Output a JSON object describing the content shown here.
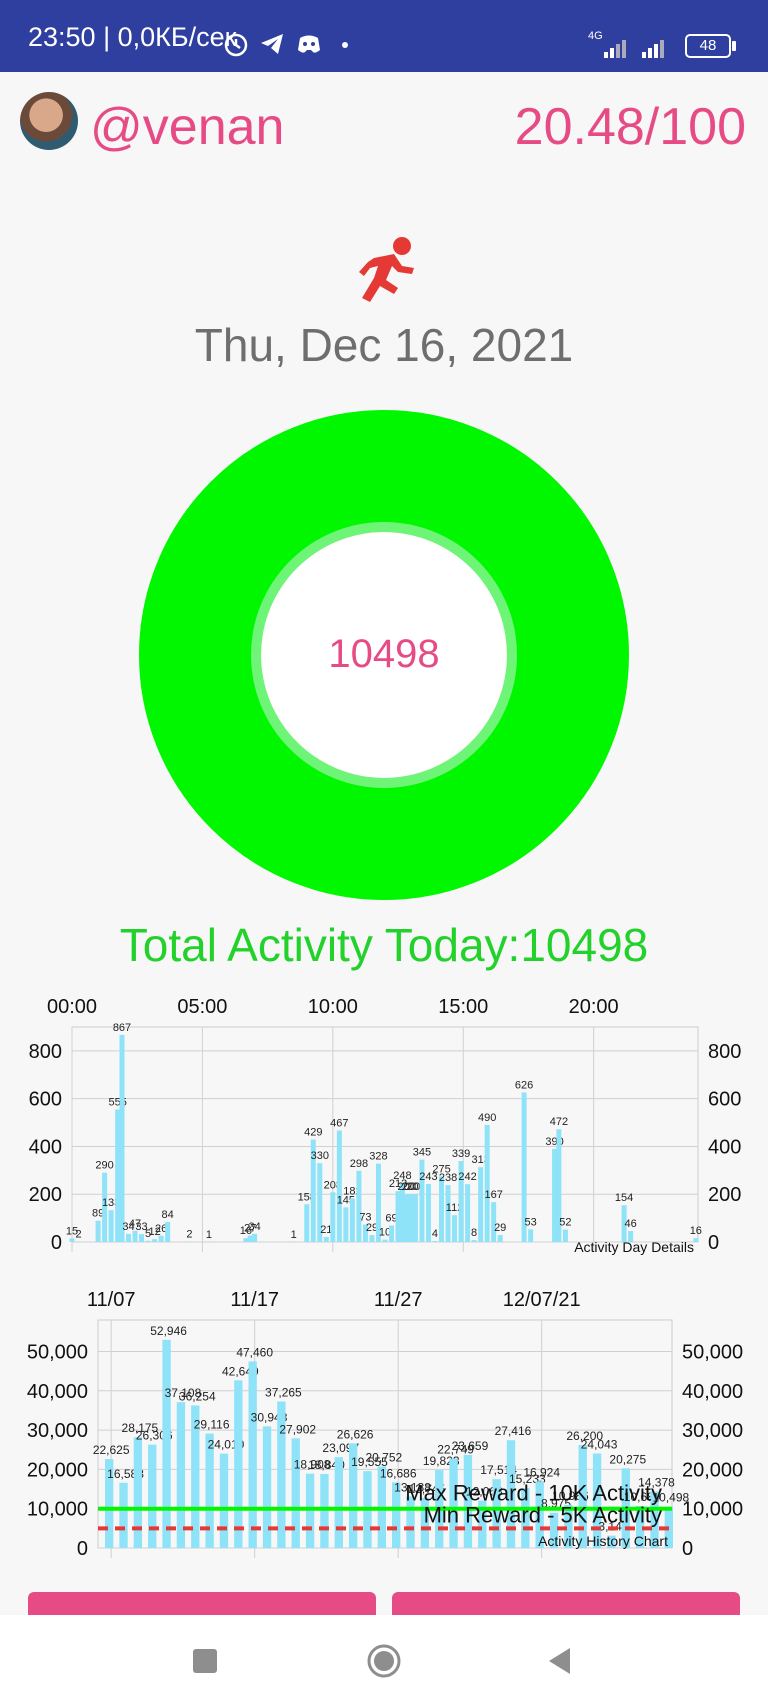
{
  "status": {
    "time": "23:50 | 0,0КБ/сек",
    "network": "4G",
    "battery": "48"
  },
  "header": {
    "username": "@venan",
    "score": "20.48/100"
  },
  "date": "Thu, Dec 16, 2021",
  "donut": {
    "value": "10498",
    "progress": 1.0
  },
  "total_activity": "Total Activity Today:10498",
  "colors": {
    "accent_pink": "#e64b86",
    "green": "#22d12a",
    "ring_green": "#00f700",
    "bar_blue": "#8fe3f9",
    "status_bar": "#2f3f9f",
    "min_line": "#e53935"
  },
  "chart_data": [
    {
      "type": "bar",
      "title": "",
      "label": "Activity Day Details",
      "x_ticks": [
        "00:00",
        "05:00",
        "10:00",
        "15:00",
        "20:00"
      ],
      "y_ticks": [
        "0",
        "200",
        "400",
        "600",
        "800"
      ],
      "ylim": [
        0,
        900
      ],
      "x_range_minutes": [
        0,
        1440
      ],
      "grid": true,
      "points": [
        {
          "t": 0,
          "v": 15
        },
        {
          "t": 15,
          "v": 2
        },
        {
          "t": 60,
          "v": 89
        },
        {
          "t": 75,
          "v": 290
        },
        {
          "t": 90,
          "v": 133
        },
        {
          "t": 105,
          "v": 555
        },
        {
          "t": 115,
          "v": 867
        },
        {
          "t": 130,
          "v": 34
        },
        {
          "t": 145,
          "v": 47
        },
        {
          "t": 160,
          "v": 33
        },
        {
          "t": 175,
          "v": 5
        },
        {
          "t": 190,
          "v": 12
        },
        {
          "t": 205,
          "v": 26
        },
        {
          "t": 220,
          "v": 84
        },
        {
          "t": 270,
          "v": 2
        },
        {
          "t": 315,
          "v": 1
        },
        {
          "t": 400,
          "v": 16
        },
        {
          "t": 410,
          "v": 27
        },
        {
          "t": 420,
          "v": 34
        },
        {
          "t": 510,
          "v": 1
        },
        {
          "t": 540,
          "v": 158
        },
        {
          "t": 555,
          "v": 429
        },
        {
          "t": 570,
          "v": 330
        },
        {
          "t": 585,
          "v": 21
        },
        {
          "t": 600,
          "v": 208
        },
        {
          "t": 615,
          "v": 467
        },
        {
          "t": 630,
          "v": 145
        },
        {
          "t": 645,
          "v": 182
        },
        {
          "t": 660,
          "v": 298
        },
        {
          "t": 675,
          "v": 73
        },
        {
          "t": 690,
          "v": 29
        },
        {
          "t": 705,
          "v": 328
        },
        {
          "t": 720,
          "v": 10
        },
        {
          "t": 735,
          "v": 69
        },
        {
          "t": 750,
          "v": 213
        },
        {
          "t": 760,
          "v": 248
        },
        {
          "t": 770,
          "v": 200
        },
        {
          "t": 780,
          "v": 200
        },
        {
          "t": 790,
          "v": 200
        },
        {
          "t": 805,
          "v": 345
        },
        {
          "t": 820,
          "v": 243
        },
        {
          "t": 835,
          "v": 4
        },
        {
          "t": 850,
          "v": 275
        },
        {
          "t": 865,
          "v": 238
        },
        {
          "t": 880,
          "v": 112
        },
        {
          "t": 895,
          "v": 339
        },
        {
          "t": 910,
          "v": 242
        },
        {
          "t": 925,
          "v": 8
        },
        {
          "t": 940,
          "v": 313
        },
        {
          "t": 955,
          "v": 490
        },
        {
          "t": 970,
          "v": 167
        },
        {
          "t": 985,
          "v": 29
        },
        {
          "t": 1040,
          "v": 626
        },
        {
          "t": 1055,
          "v": 53
        },
        {
          "t": 1110,
          "v": 390
        },
        {
          "t": 1120,
          "v": 472
        },
        {
          "t": 1135,
          "v": 52
        },
        {
          "t": 1270,
          "v": 154
        },
        {
          "t": 1285,
          "v": 46
        },
        {
          "t": 1435,
          "v": 16
        }
      ]
    },
    {
      "type": "bar",
      "title": "",
      "label": "Activity History Chart",
      "x_ticks": [
        "11/07",
        "11/17",
        "11/27",
        "12/07/21"
      ],
      "y_ticks": [
        "0",
        "10,000",
        "20,000",
        "30,000",
        "40,000",
        "50,000"
      ],
      "ylim": [
        0,
        58000
      ],
      "grid": true,
      "values": [
        22625,
        16588,
        28175,
        26306,
        52946,
        37108,
        36254,
        29116,
        24010,
        42649,
        47460,
        30948,
        37265,
        27902,
        18908,
        18840,
        23097,
        26626,
        19555,
        20752,
        16686,
        13138,
        12745,
        19823,
        22749,
        23659,
        12068,
        17514,
        27416,
        15233,
        16924,
        8975,
        10986,
        26200,
        24043,
        3147,
        20275,
        10689,
        14378,
        10498
      ],
      "value_labels": [
        "22,625",
        "16,588",
        "28,175",
        "26,306",
        "52,946",
        "37,108",
        "36,254",
        "29,116",
        "24,010",
        "42,649",
        "47,460",
        "30,948",
        "37,265",
        "27,902",
        "18,908",
        "18,840",
        "23,097",
        "26,626",
        "19,555",
        "20,752",
        "16,686",
        "13,138",
        "12,745",
        "19,823",
        "22,749",
        "23,659",
        "12,068",
        "17,514",
        "27,416",
        "15,233",
        "16,924",
        "8,975",
        "10,986",
        "26,200",
        "24,043",
        "3,147",
        "20,275",
        "10,689",
        "14,378",
        "10,498"
      ],
      "lines": [
        {
          "name": "Max Reward - 10K Activity",
          "value": 10000,
          "style": "solid"
        },
        {
          "name": "Min Reward - 5K Activity",
          "value": 5000,
          "style": "dashed"
        }
      ]
    }
  ]
}
